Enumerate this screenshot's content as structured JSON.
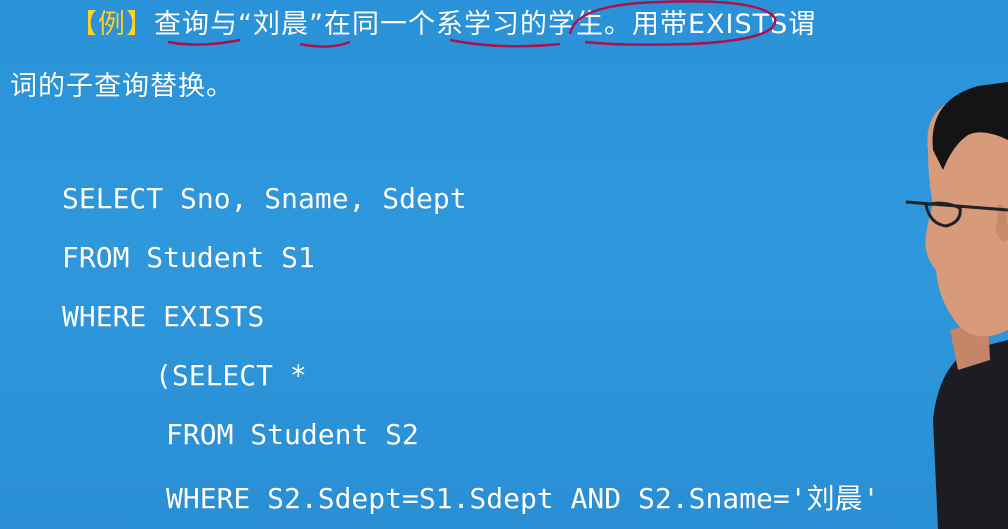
{
  "slide": {
    "title_bracket": "【例】",
    "title_main": "查询与“刘晨”在同一个系学习的学生。用带EXISTS谓",
    "title_line2": "词的子查询替换。",
    "code_lines": [
      "SELECT Sno, Sname, Sdept",
      "FROM Student S1",
      "WHERE EXISTS",
      "(SELECT *",
      "FROM Student S2",
      "WHERE S2.Sdept=S1.Sdept AND S2.Sname='刘晨'"
    ]
  },
  "colors": {
    "background": "#2e96da",
    "text": "#ffffff",
    "bracket": "#ffd02a",
    "annotation": "#b0104a"
  }
}
